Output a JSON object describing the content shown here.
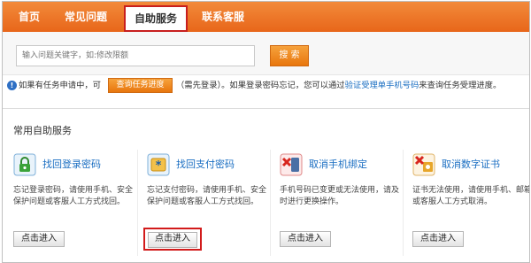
{
  "nav": {
    "items": [
      "首页",
      "常见问题",
      "自助服务",
      "联系客服"
    ],
    "active_index": 2
  },
  "search": {
    "placeholder": "输入问题关键字，如:修改限额",
    "button_label": "搜 索"
  },
  "notice": {
    "prefix": "如果有任务申请中，可",
    "progress_button": "查询任务进度",
    "text_a": "（需先登录）。如果登录密码忘记，您可以通过",
    "link_text": "验证受理单手机号码",
    "text_b": "来查询任务受理进度。"
  },
  "services": {
    "title": "常用自助服务",
    "cards": [
      {
        "icon": "lock-icon",
        "title": "找回登录密码",
        "description": "忘记登录密码，请使用手机、安全保护问题或客服人工方式找回。",
        "button": "点击进入"
      },
      {
        "icon": "asterisk-key-icon",
        "title": "找回支付密码",
        "description": "忘记支付密码，请使用手机、安全保护问题或客服人工方式找回。",
        "button": "点击进入"
      },
      {
        "icon": "phone-cancel-icon",
        "title": "取消手机绑定",
        "description": "手机号码已变更或无法使用，请及时进行更换操作。",
        "button": "点击进入"
      },
      {
        "icon": "certificate-cancel-icon",
        "title": "取消数字证书",
        "description": "证书无法使用，请使用手机、邮箱或客服人工方式取消。",
        "button": "点击进入"
      }
    ]
  },
  "colors": {
    "nav_orange": "#e8661a",
    "link_blue": "#1a6ec2",
    "highlight_red": "#d21b1b"
  }
}
